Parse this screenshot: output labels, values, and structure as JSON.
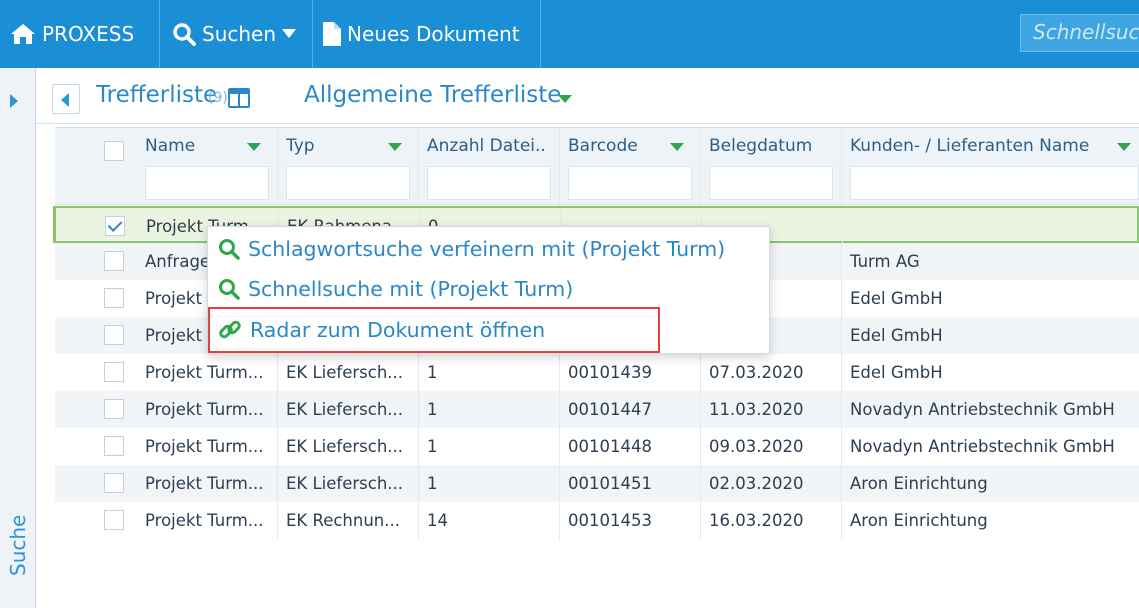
{
  "topbar": {
    "home_label": "PROXESS",
    "search_label": "Suchen",
    "newdoc_label": "Neues Dokument",
    "quicksearch_placeholder": "Schnellsuc"
  },
  "sidebar": {
    "label": "Suche"
  },
  "list_header": {
    "title": "Trefferliste",
    "count": "(9)",
    "view_name": "Allgemeine Trefferliste"
  },
  "table": {
    "columns": [
      "Name",
      "Typ",
      "Anzahl Datei...",
      "Barcode",
      "Belegdatum",
      "Kunden- / Lieferanten Name"
    ],
    "rows": [
      {
        "checked": true,
        "name": "Projekt Turm",
        "typ": "EK Rahmena",
        "anzahl": "0",
        "barcode": "",
        "datum": "",
        "kunde": ""
      },
      {
        "checked": false,
        "name": "Anfrage",
        "typ": "",
        "anzahl": "",
        "barcode": "",
        "datum": "021",
        "kunde": "Turm AG"
      },
      {
        "checked": false,
        "name": "Projekt",
        "typ": "",
        "anzahl": "",
        "barcode": "",
        "datum": "020",
        "kunde": "Edel GmbH"
      },
      {
        "checked": false,
        "name": "Projekt",
        "typ": "",
        "anzahl": "",
        "barcode": "",
        "datum": "020",
        "kunde": "Edel GmbH"
      },
      {
        "checked": false,
        "name": "Projekt Turm...",
        "typ": "EK Liefersch...",
        "anzahl": "1",
        "barcode": "00101439",
        "datum": "07.03.2020",
        "kunde": "Edel GmbH"
      },
      {
        "checked": false,
        "name": "Projekt Turm...",
        "typ": "EK Liefersch...",
        "anzahl": "1",
        "barcode": "00101447",
        "datum": "11.03.2020",
        "kunde": "Novadyn Antriebstechnik GmbH"
      },
      {
        "checked": false,
        "name": "Projekt Turm...",
        "typ": "EK Liefersch...",
        "anzahl": "1",
        "barcode": "00101448",
        "datum": "09.03.2020",
        "kunde": "Novadyn Antriebstechnik GmbH"
      },
      {
        "checked": false,
        "name": "Projekt Turm...",
        "typ": "EK Liefersch...",
        "anzahl": "1",
        "barcode": "00101451",
        "datum": "02.03.2020",
        "kunde": "Aron Einrichtung"
      },
      {
        "checked": false,
        "name": "Projekt Turm...",
        "typ": "EK Rechnun...",
        "anzahl": "14",
        "barcode": "00101453",
        "datum": "16.03.2020",
        "kunde": "Aron Einrichtung"
      }
    ]
  },
  "context_menu": {
    "items": [
      {
        "label": "Schlagwortsuche verfeinern mit (Projekt Turm)",
        "icon": "search-icon"
      },
      {
        "label": "Schnellsuche mit (Projekt Turm)",
        "icon": "search-icon"
      },
      {
        "label": "Radar zum Dokument öffnen",
        "icon": "link-icon"
      }
    ]
  },
  "colors": {
    "topbar": "#1a8fd6",
    "accent": "#2c87c9",
    "sort_indicator": "#2fa64d",
    "highlight_frame": "#e2403a"
  }
}
